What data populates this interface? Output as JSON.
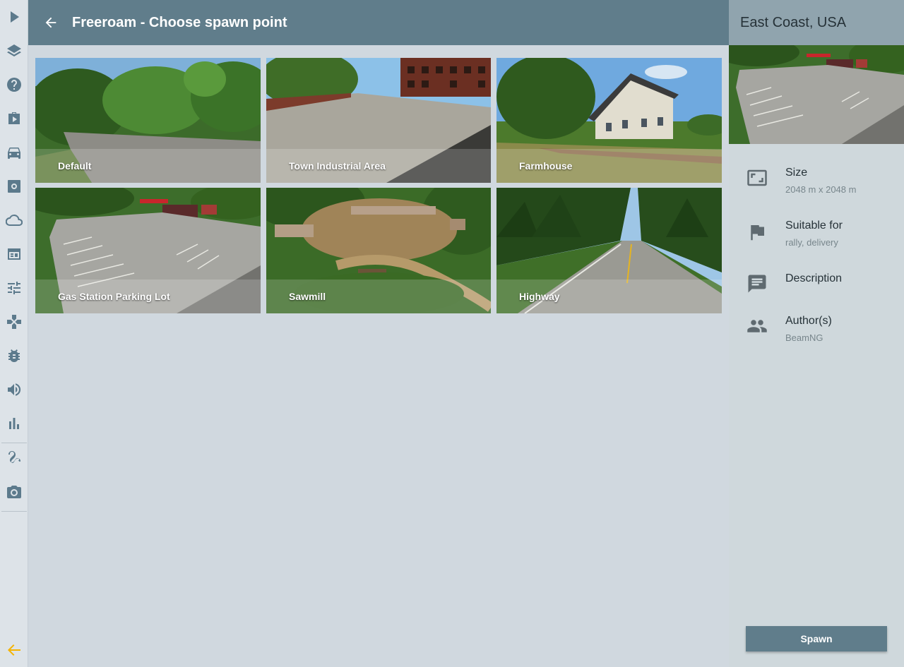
{
  "header": {
    "title": "Freeroam - Choose spawn point"
  },
  "sidebar": {
    "icons": [
      "play-icon",
      "layers-icon",
      "help-icon",
      "mission-icon",
      "car-icon",
      "settings-icon",
      "cloud-icon",
      "dashboard-icon",
      "tune-icon",
      "gamepad-icon",
      "bug-icon",
      "volume-icon",
      "stats-icon",
      "route-icon",
      "camera-icon",
      "collapse-arrow-icon"
    ],
    "accent_color": "#f5b300"
  },
  "spawn_points": [
    {
      "name": "Default"
    },
    {
      "name": "Town Industrial Area"
    },
    {
      "name": "Farmhouse"
    },
    {
      "name": "Gas Station Parking Lot"
    },
    {
      "name": "Sawmill"
    },
    {
      "name": "Highway"
    }
  ],
  "panel": {
    "title": "East Coast, USA",
    "size_label": "Size",
    "size_value": "2048 m x 2048 m",
    "suitable_label": "Suitable for",
    "suitable_value": "rally, delivery",
    "description_label": "Description",
    "authors_label": "Author(s)",
    "authors_value": "BeamNG",
    "spawn_label": "Spawn"
  }
}
